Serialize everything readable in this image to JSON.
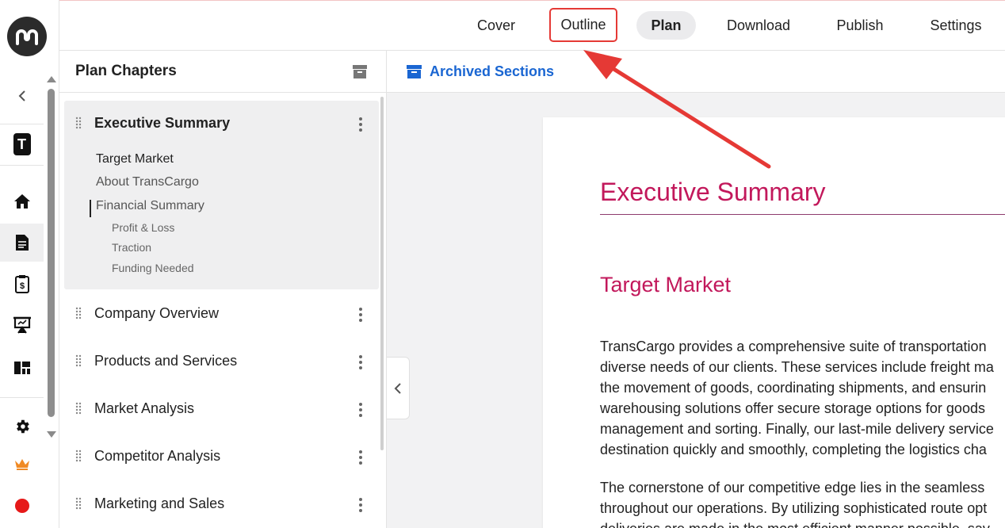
{
  "nav": {
    "tabs": [
      {
        "label": "Cover"
      },
      {
        "label": "Outline"
      },
      {
        "label": "Plan"
      },
      {
        "label": "Download"
      },
      {
        "label": "Publish"
      },
      {
        "label": "Settings"
      }
    ],
    "active_tab": "Plan",
    "highlighted_tab": "Outline"
  },
  "sidebar": {
    "workspace_initial": "T",
    "icons": [
      "home-icon",
      "document-icon",
      "finance-icon",
      "presentation-icon",
      "dashboard-icon",
      "settings-icon",
      "crown-icon",
      "record-icon"
    ],
    "active": "document-icon"
  },
  "chapters": {
    "title": "Plan Chapters",
    "items": [
      {
        "label": "Executive Summary",
        "selected": true,
        "subsections": [
          {
            "label": "Target Market",
            "current": true
          },
          {
            "label": "About TransCargo"
          },
          {
            "label": "Financial Summary"
          },
          {
            "label": "Profit & Loss"
          },
          {
            "label": "Traction"
          },
          {
            "label": "Funding Needed"
          }
        ]
      },
      {
        "label": "Company Overview"
      },
      {
        "label": "Products and Services"
      },
      {
        "label": "Market Analysis"
      },
      {
        "label": "Competitor Analysis"
      },
      {
        "label": "Marketing and Sales"
      }
    ]
  },
  "main": {
    "archived_link": "Archived Sections",
    "document": {
      "heading": "Executive Summary",
      "subheading": "Target Market",
      "paragraph1": "TransCargo provides a comprehensive suite of transportation\ndiverse needs of our clients. These services include freight ma\nthe movement of goods, coordinating shipments, and ensurin\nwarehousing solutions offer secure storage options for goods\nmanagement and sorting. Finally, our last-mile delivery service\ndestination quickly and smoothly, completing the logistics cha",
      "paragraph2": "The cornerstone of our competitive edge lies in the seamless\nthroughout our operations. By utilizing sophisticated route opt\ndeliveries are made in the most efficient manner possible, sav"
    }
  },
  "colors": {
    "heading": "#c2185b",
    "link": "#1a66d2",
    "annotation": "#e53935"
  }
}
